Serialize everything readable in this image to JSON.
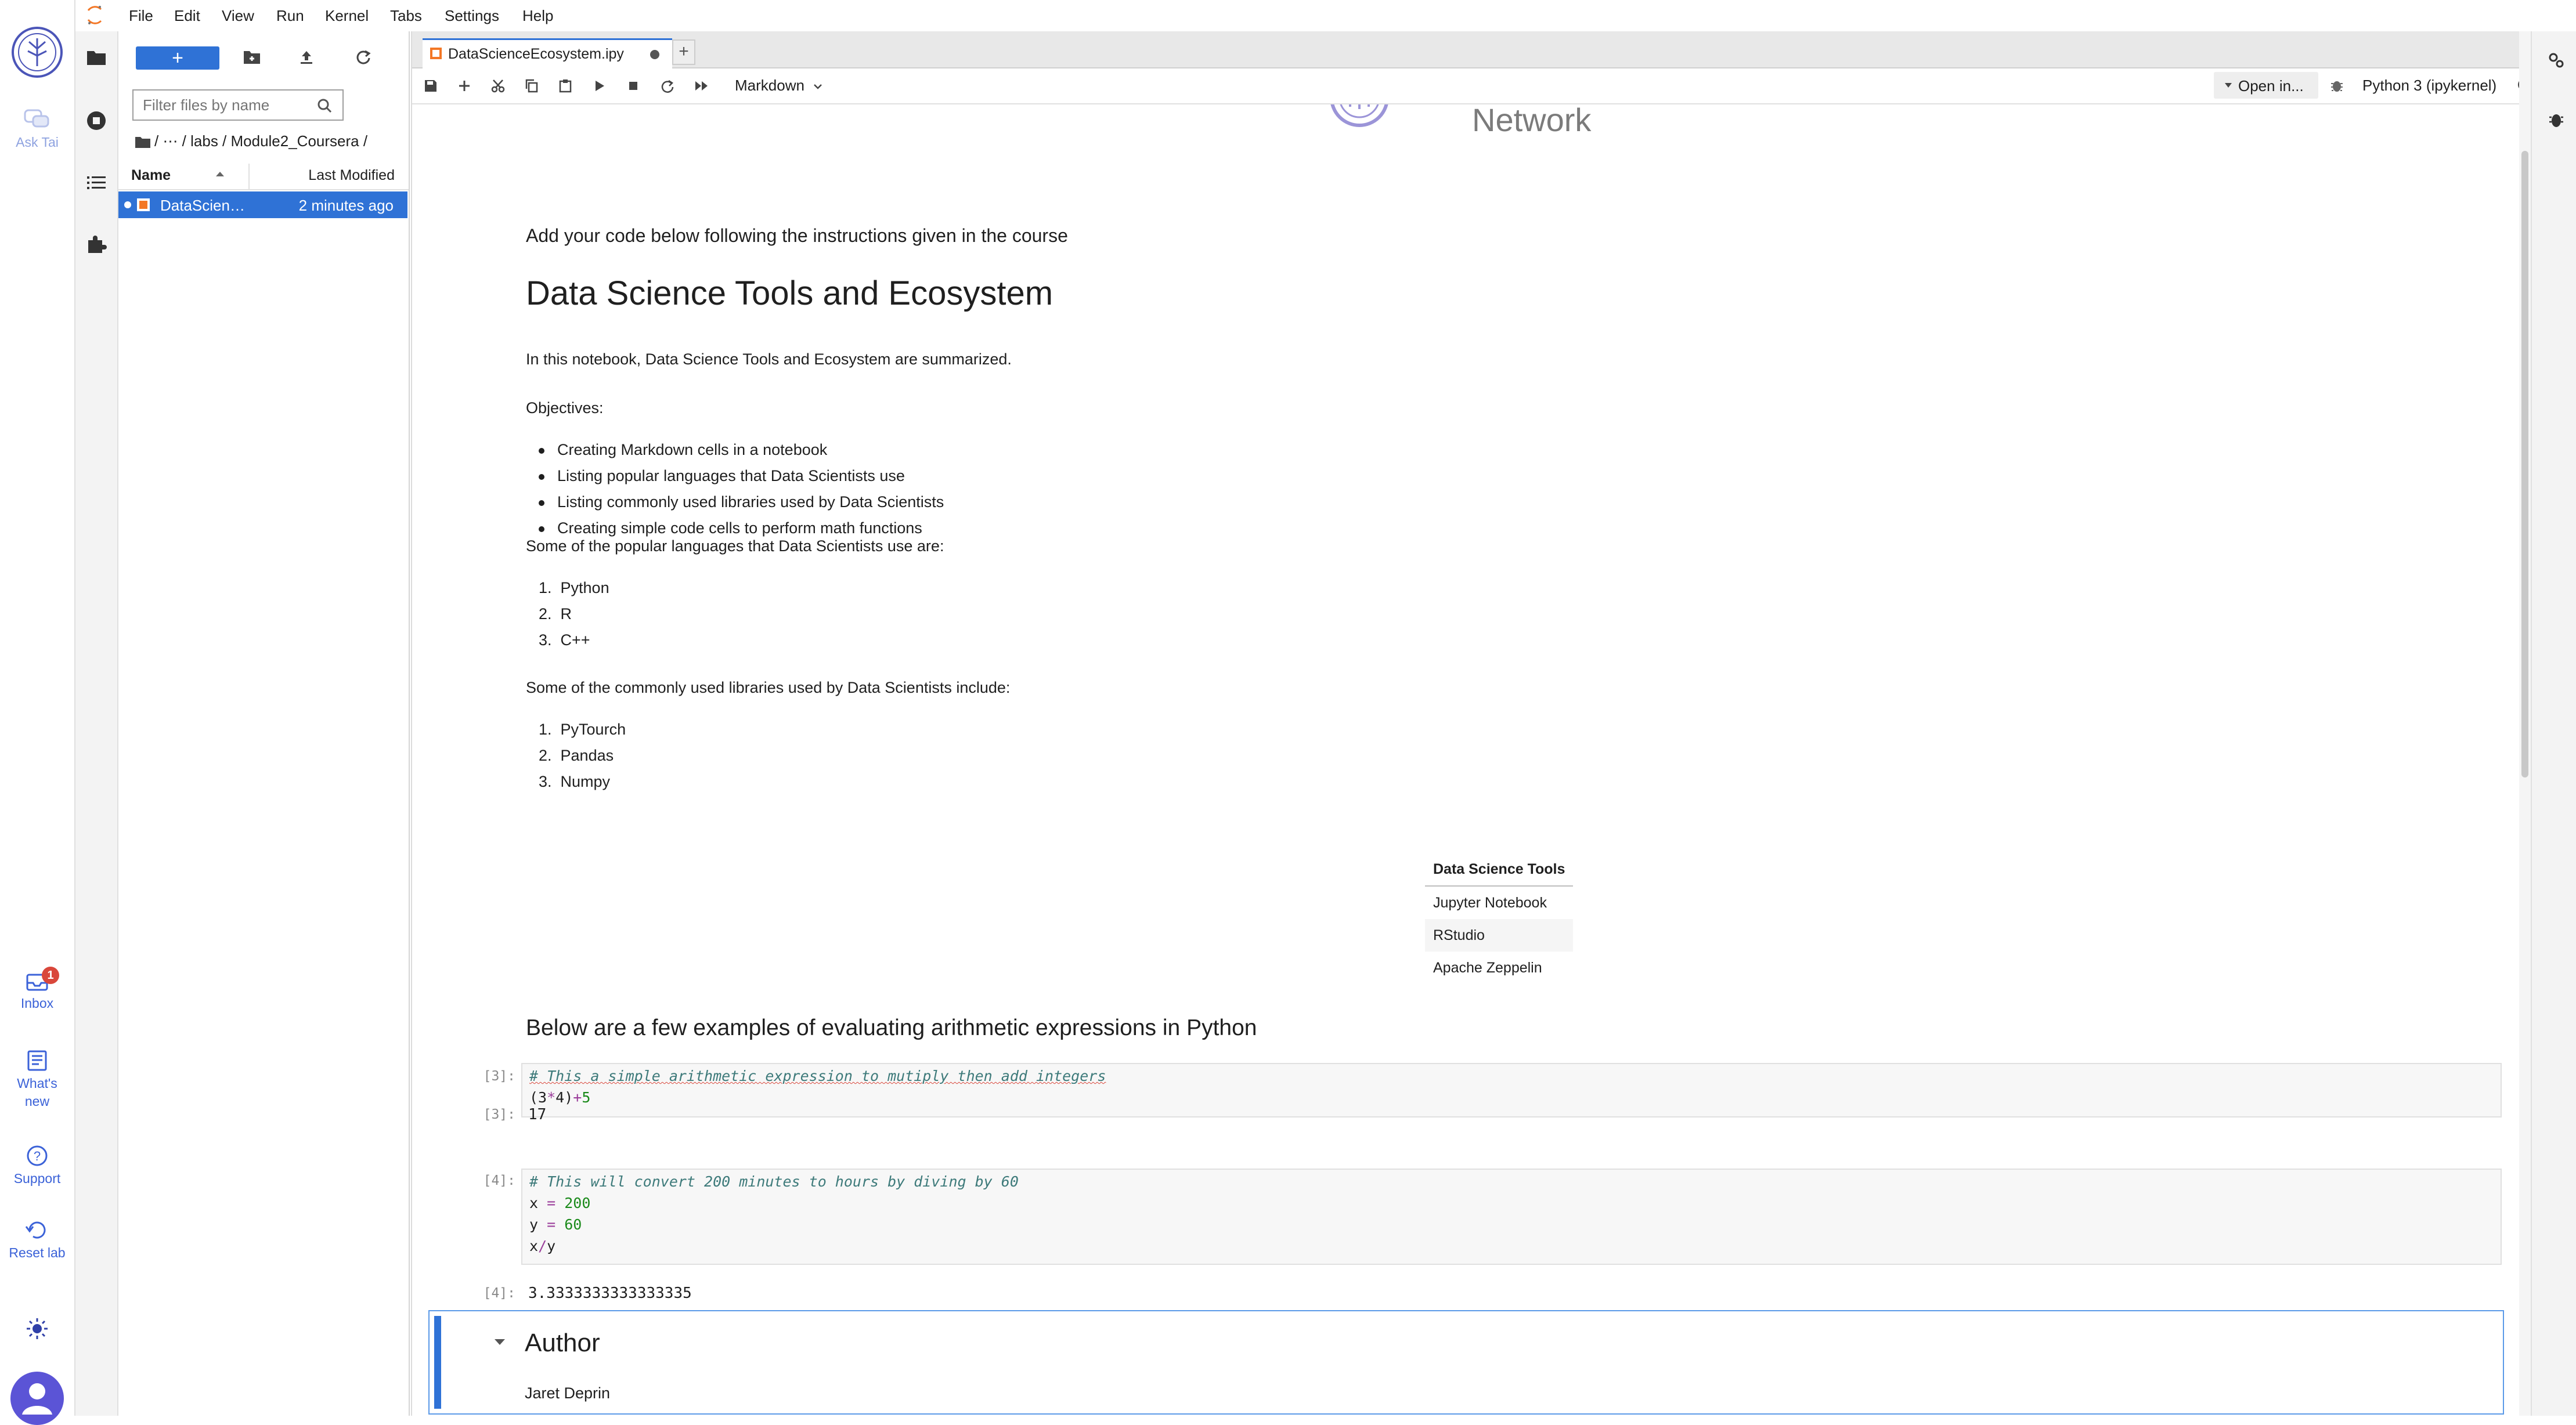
{
  "menubar": {
    "items": [
      "File",
      "Edit",
      "View",
      "Run",
      "Kernel",
      "Tabs",
      "Settings",
      "Help"
    ]
  },
  "rail": {
    "ask_label": "Ask Tai",
    "inbox_label": "Inbox",
    "inbox_badge": "1",
    "whatsnew_label": "What's new",
    "support_label": "Support",
    "reset_label": "Reset lab"
  },
  "file_browser": {
    "new_button": "+",
    "filter_placeholder": "Filter files by name",
    "breadcrumbs": "/   ⋯   / labs / Module2_Coursera /",
    "col_name": "Name",
    "col_modified": "Last Modified",
    "files": [
      {
        "name": "DataScien…",
        "modified": "2 minutes ago"
      }
    ]
  },
  "editor": {
    "tab_title": "DataScienceEcosystem.ipy",
    "cell_type": "Markdown",
    "open_in": "Open in...",
    "kernel": "Python 3 (ipykernel)"
  },
  "notebook": {
    "logo_text": "Network",
    "intro": "Add your code below following the instructions given in the course",
    "title": "Data Science Tools and Ecosystem",
    "summary": "In this notebook, Data Science Tools and Ecosystem are summarized.",
    "objectives_heading": "Objectives:",
    "objectives": [
      "Creating Markdown cells in a notebook",
      "Listing popular languages that Data Scientists use",
      "Listing commonly used libraries used by Data Scientists",
      "Creating simple code cells to perform math functions"
    ],
    "languages_heading": "Some of the popular languages that Data Scientists use are:",
    "languages": [
      "Python",
      "R",
      "C++"
    ],
    "libraries_heading": "Some of the commonly used libraries used by Data Scientists include:",
    "libraries": [
      "PyTourch",
      "Pandas",
      "Numpy"
    ],
    "tools_table": {
      "header": "Data Science Tools",
      "rows": [
        "Jupyter Notebook",
        "RStudio",
        "Apache Zeppelin"
      ]
    },
    "examples_heading": "Below are a few examples of evaluating arithmetic expressions in Python",
    "cell1": {
      "prompt": "[3]:",
      "comment": "# This a simple arithmetic expression to mutiply then add integers",
      "code_a": "(3",
      "code_op1": "*",
      "code_b": "4)",
      "code_op2": "+",
      "code_c": "5",
      "output_prompt": "[3]:",
      "output": "17"
    },
    "cell2": {
      "prompt": "[4]:",
      "comment": "# This will convert 200 minutes to hours by diving by 60",
      "line_x_var": "x",
      "line_x_val": "200",
      "line_y_var": "y",
      "line_y_val": "60",
      "line_div_a": "x",
      "line_div_op": "/",
      "line_div_b": "y",
      "output_prompt": "[4]:",
      "output": "3.3333333333333335"
    },
    "author_heading": "Author",
    "author_name": "Jaret Deprin"
  }
}
